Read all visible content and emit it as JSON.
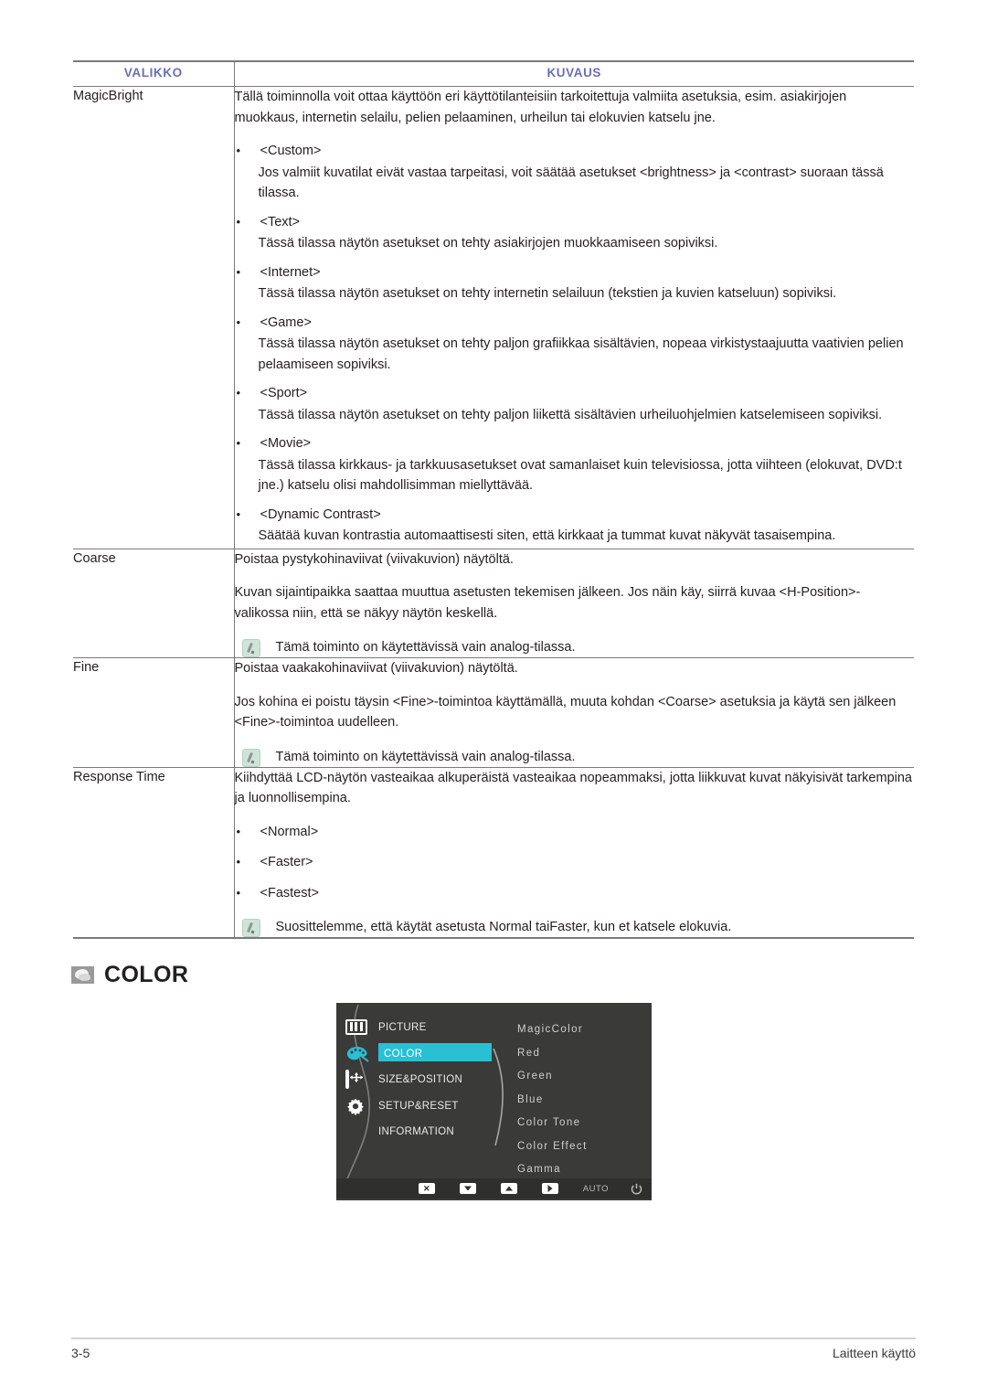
{
  "table": {
    "headers": {
      "menu": "VALIKKO",
      "description": "KUVAUS"
    },
    "rows": [
      {
        "menu": "MagicBright",
        "intro": "Tällä toiminnolla voit ottaa käyttöön eri käyttötilanteisiin tarkoitettuja valmiita asetuksia, esim. asiakirjojen muokkaus, internetin selailu, pelien pelaaminen, urheilun tai elokuvien katselu jne.",
        "bullets": [
          {
            "label": "<Custom>",
            "desc": "Jos valmiit kuvatilat eivät vastaa tarpeitasi, voit säätää asetukset <brightness> ja <contrast> suoraan tässä tilassa."
          },
          {
            "label": "<Text>",
            "desc": "Tässä tilassa näytön asetukset on tehty asiakirjojen muokkaamiseen sopiviksi."
          },
          {
            "label": "<Internet>",
            "desc": "Tässä tilassa näytön asetukset on tehty internetin selailuun (tekstien ja kuvien katseluun) sopiviksi."
          },
          {
            "label": "<Game>",
            "desc": "Tässä tilassa näytön asetukset on tehty paljon grafiikkaa sisältävien, nopeaa virkistystaajuutta vaativien pelien pelaamiseen sopiviksi."
          },
          {
            "label": "<Sport>",
            "desc": "Tässä tilassa näytön asetukset on tehty paljon liikettä sisältävien urheiluohjelmien katselemiseen sopiviksi."
          },
          {
            "label": "<Movie>",
            "desc": "Tässä tilassa kirkkaus- ja tarkkuusasetukset ovat samanlaiset kuin televisiossa, jotta viihteen (elokuvat, DVD:t jne.) katselu olisi mahdollisimman miellyttävää."
          },
          {
            "label": "<Dynamic Contrast>",
            "desc": "Säätää kuvan kontrastia automaattisesti siten, että kirkkaat ja tummat kuvat näkyvät tasaisempina."
          }
        ]
      },
      {
        "menu": "Coarse",
        "intro": "Poistaa pystykohinaviivat (viivakuvion) näytöltä.",
        "para2": "Kuvan sijaintipaikka saattaa muuttua asetusten tekemisen jälkeen. Jos näin käy, siirrä kuvaa <H-Position>-valikossa niin, että se näkyy näytön keskellä.",
        "note": "Tämä toiminto on käytettävissä vain analog-tilassa."
      },
      {
        "menu": "Fine",
        "intro": "Poistaa vaakakohinaviivat (viivakuvion) näytöltä.",
        "para2": "Jos kohina ei poistu täysin <Fine>-toimintoa käyttämällä, muuta kohdan <Coarse> asetuksia ja käytä sen jälkeen <Fine>-toimintoa uudelleen.",
        "note": "Tämä toiminto on käytettävissä vain analog-tilassa."
      },
      {
        "menu": "Response Time",
        "intro": "Kiihdyttää LCD-näytön vasteaikaa alkuperäistä vasteaikaa nopeammaksi, jotta liikkuvat kuvat näkyisivät tarkempina ja luonnollisempina.",
        "options": [
          "<Normal>",
          "<Faster>",
          "<Fastest>"
        ],
        "note": "Suosittelemme, että käytät asetusta Normal taiFaster, kun et katsele elokuvia."
      }
    ]
  },
  "section": {
    "icon": "color-swatch-icon",
    "title": "COLOR"
  },
  "osd": {
    "menu_items": [
      {
        "label": "PICTURE",
        "icon": "picture-icon",
        "selected": false
      },
      {
        "label": "COLOR",
        "icon": "palette-icon",
        "selected": true
      },
      {
        "label": "SIZE&POSITION",
        "icon": "size-position-icon",
        "selected": false
      },
      {
        "label": "SETUP&RESET",
        "icon": "gear-icon",
        "selected": false
      },
      {
        "label": "INFORMATION",
        "icon": "info-icon",
        "selected": false
      }
    ],
    "submenu_items": [
      "MagicColor",
      "Red",
      "Green",
      "Blue",
      "Color Tone",
      "Color Effect",
      "Gamma"
    ],
    "toolbar": {
      "exit": "exit-icon",
      "down": "arrow-down-icon",
      "up": "arrow-up-icon",
      "right": "arrow-right-icon",
      "auto": "AUTO",
      "power": "power-icon"
    },
    "colors": {
      "background": "#3a3a38",
      "highlight": "#29bfd4",
      "label": "#e9e9e9",
      "submenu_label": "#cfcfcf"
    }
  },
  "footer": {
    "page": "3-5",
    "chapter": "Laitteen käyttö"
  },
  "theme": {
    "header_color": "#6b6fb5",
    "rule_color": "#7a7a7a",
    "text_color": "#231f20"
  }
}
